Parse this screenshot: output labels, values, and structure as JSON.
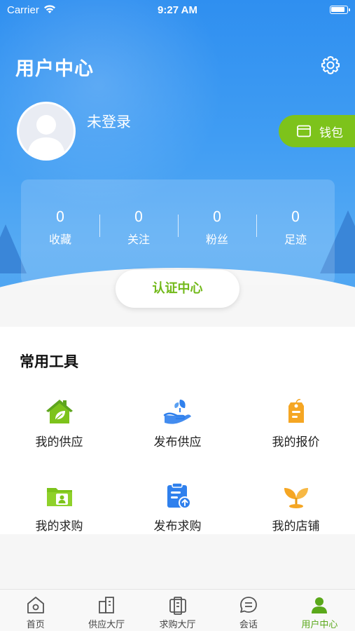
{
  "status_bar": {
    "carrier": "Carrier",
    "time": "9:27 AM"
  },
  "header": {
    "title": "用户中心",
    "username": "未登录",
    "wallet_label": "钱包",
    "stats": [
      {
        "value": "0",
        "label": "收藏"
      },
      {
        "value": "0",
        "label": "关注"
      },
      {
        "value": "0",
        "label": "粉丝"
      },
      {
        "value": "0",
        "label": "足迹"
      }
    ],
    "cert_label": "认证中心"
  },
  "tools": {
    "title": "常用工具",
    "items": [
      {
        "label": "我的供应",
        "icon": "house-leaf-icon"
      },
      {
        "label": "发布供应",
        "icon": "hand-seedling-icon"
      },
      {
        "label": "我的报价",
        "icon": "price-tag-icon"
      },
      {
        "label": "我的求购",
        "icon": "folder-user-icon"
      },
      {
        "label": "发布求购",
        "icon": "clipboard-upload-icon"
      },
      {
        "label": "我的店铺",
        "icon": "sprout-icon"
      }
    ]
  },
  "tabbar": {
    "tabs": [
      {
        "label": "首页",
        "icon": "home-icon"
      },
      {
        "label": "供应大厅",
        "icon": "supply-hall-icon"
      },
      {
        "label": "求购大厅",
        "icon": "purchase-hall-icon"
      },
      {
        "label": "会话",
        "icon": "chat-icon"
      },
      {
        "label": "用户中心",
        "icon": "user-icon",
        "active": true
      }
    ]
  },
  "colors": {
    "header_blue": "#3f9cf3",
    "accent_green": "#7dc31b",
    "icon_orange": "#f5a623",
    "icon_blue": "#2f80ed"
  }
}
